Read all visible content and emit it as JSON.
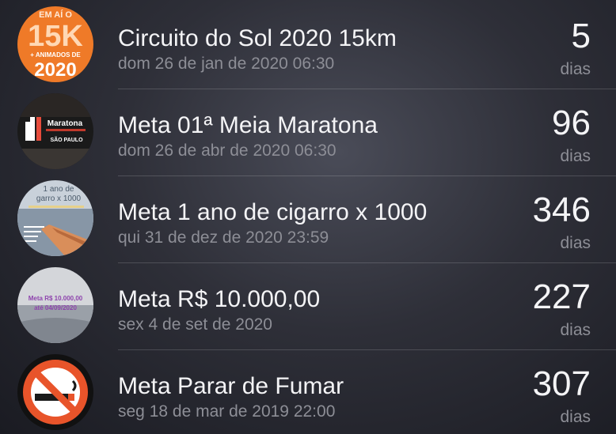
{
  "events": [
    {
      "title": "Circuito do Sol 2020 15km",
      "date": "dom 26 de jan de 2020 06:30",
      "count": "5",
      "unit": "dias",
      "thumb": {
        "icon": "race-poster-thumbnail",
        "lines": [
          "EM AÍ O",
          "15K",
          "+ ANIMADOS DE",
          "2020"
        ],
        "color": "#f07f2a"
      }
    },
    {
      "title": "Meta 01ª Meia Maratona",
      "date": "dom 26 de abr de 2020 06:30",
      "count": "96",
      "unit": "dias",
      "thumb": {
        "icon": "half-marathon-logo-thumbnail",
        "lines": [
          "Maratona",
          "SÃO PAULO"
        ],
        "color": "#c0392b"
      }
    },
    {
      "title": "Meta 1 ano de cigarro x 1000",
      "date": "qui 31 de dez de 2020 23:59",
      "count": "346",
      "unit": "dias",
      "thumb": {
        "icon": "cigarette-note-thumbnail",
        "lines": [
          "1 ano de",
          "garro x 1000"
        ],
        "color": "#b8c4d0"
      }
    },
    {
      "title": "Meta R$ 10.000,00",
      "date": "sex 4 de set de 2020",
      "count": "227",
      "unit": "dias",
      "thumb": {
        "icon": "savings-goal-thumbnail",
        "lines": [
          "Meta R$ 10.000,00",
          "até 04/09/2020"
        ],
        "color": "#9b59b6"
      }
    },
    {
      "title": "Meta Parar de Fumar",
      "date": "seg 18 de mar de 2019 22:00",
      "count": "307",
      "unit": "dias",
      "thumb": {
        "icon": "no-smoking-icon",
        "color": "#e8542a"
      }
    }
  ]
}
